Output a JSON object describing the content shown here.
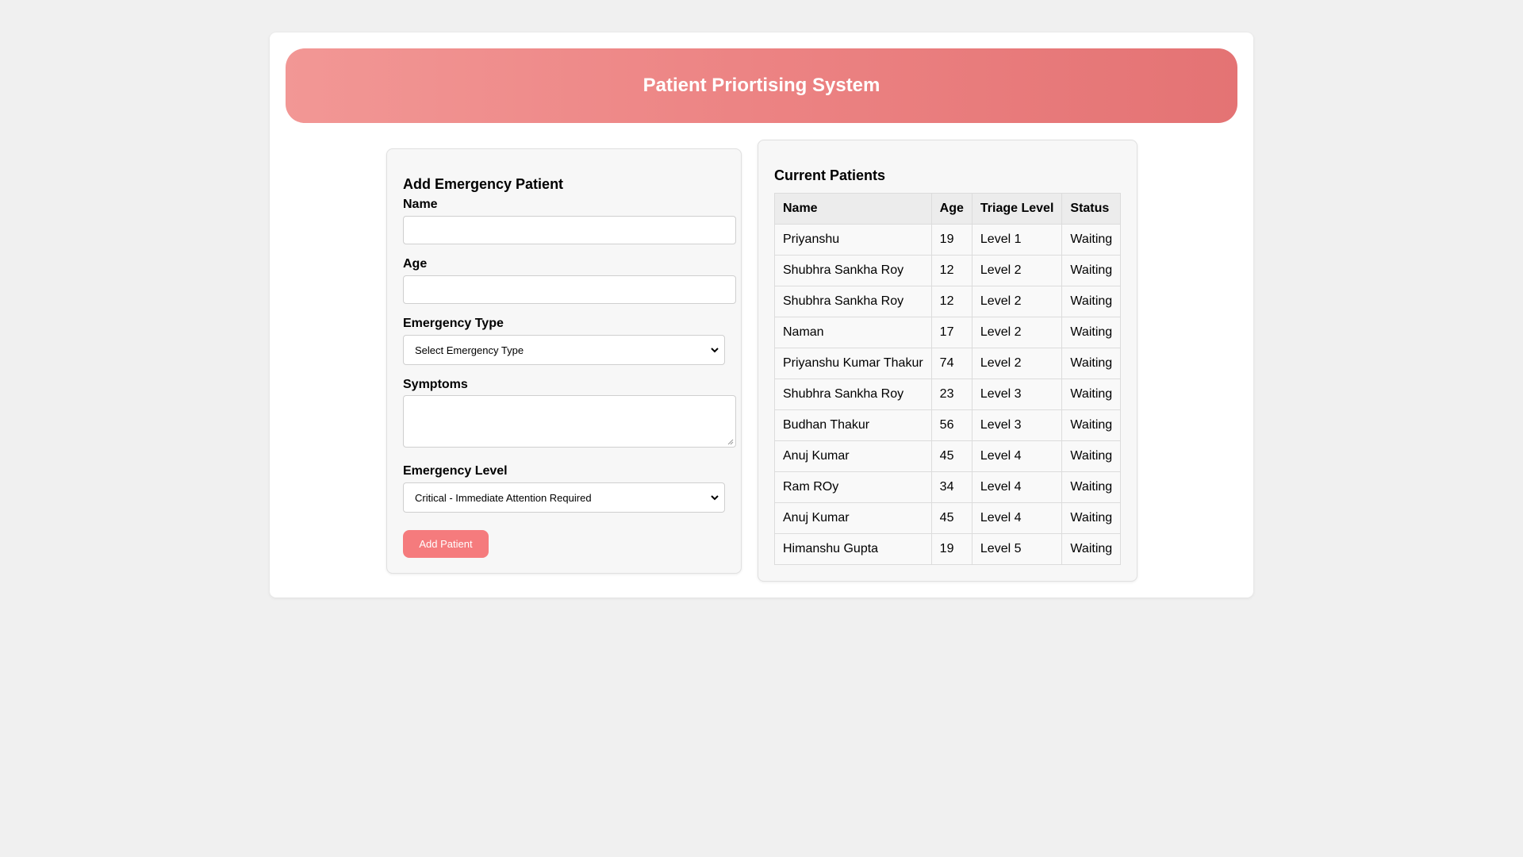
{
  "header": {
    "title": "Patient Priortising System"
  },
  "form": {
    "title": "Add Emergency Patient",
    "name_label": "Name",
    "name_value": "",
    "age_label": "Age",
    "age_value": "",
    "emergency_type_label": "Emergency Type",
    "emergency_type_selected": "Select Emergency Type",
    "symptoms_label": "Symptoms",
    "symptoms_value": "",
    "emergency_level_label": "Emergency Level",
    "emergency_level_selected": "Critical - Immediate Attention Required",
    "submit_label": "Add Patient"
  },
  "patients": {
    "title": "Current Patients",
    "columns": [
      "Name",
      "Age",
      "Triage Level",
      "Status"
    ],
    "rows": [
      {
        "name": "Priyanshu",
        "age": "19",
        "triage": "Level 1",
        "status": "Waiting"
      },
      {
        "name": "Shubhra Sankha Roy",
        "age": "12",
        "triage": "Level 2",
        "status": "Waiting"
      },
      {
        "name": "Shubhra Sankha Roy",
        "age": "12",
        "triage": "Level 2",
        "status": "Waiting"
      },
      {
        "name": "Naman",
        "age": "17",
        "triage": "Level 2",
        "status": "Waiting"
      },
      {
        "name": "Priyanshu Kumar Thakur",
        "age": "74",
        "triage": "Level 2",
        "status": "Waiting"
      },
      {
        "name": "Shubhra Sankha Roy",
        "age": "23",
        "triage": "Level 3",
        "status": "Waiting"
      },
      {
        "name": "Budhan Thakur",
        "age": "56",
        "triage": "Level 3",
        "status": "Waiting"
      },
      {
        "name": "Anuj Kumar",
        "age": "45",
        "triage": "Level 4",
        "status": "Waiting"
      },
      {
        "name": "Ram ROy",
        "age": "34",
        "triage": "Level 4",
        "status": "Waiting"
      },
      {
        "name": "Anuj Kumar",
        "age": "45",
        "triage": "Level 4",
        "status": "Waiting"
      },
      {
        "name": "Himanshu Gupta",
        "age": "19",
        "triage": "Level 5",
        "status": "Waiting"
      }
    ]
  },
  "colors": {
    "page_bg": "#f0f0f0",
    "header_gradient_start": "#f29795",
    "header_gradient_end": "#e47374",
    "button_bg": "#f57b7d"
  },
  "icons": {
    "select_chevron": "chevron-down-icon",
    "textarea_resize": "resize-grip-icon"
  }
}
